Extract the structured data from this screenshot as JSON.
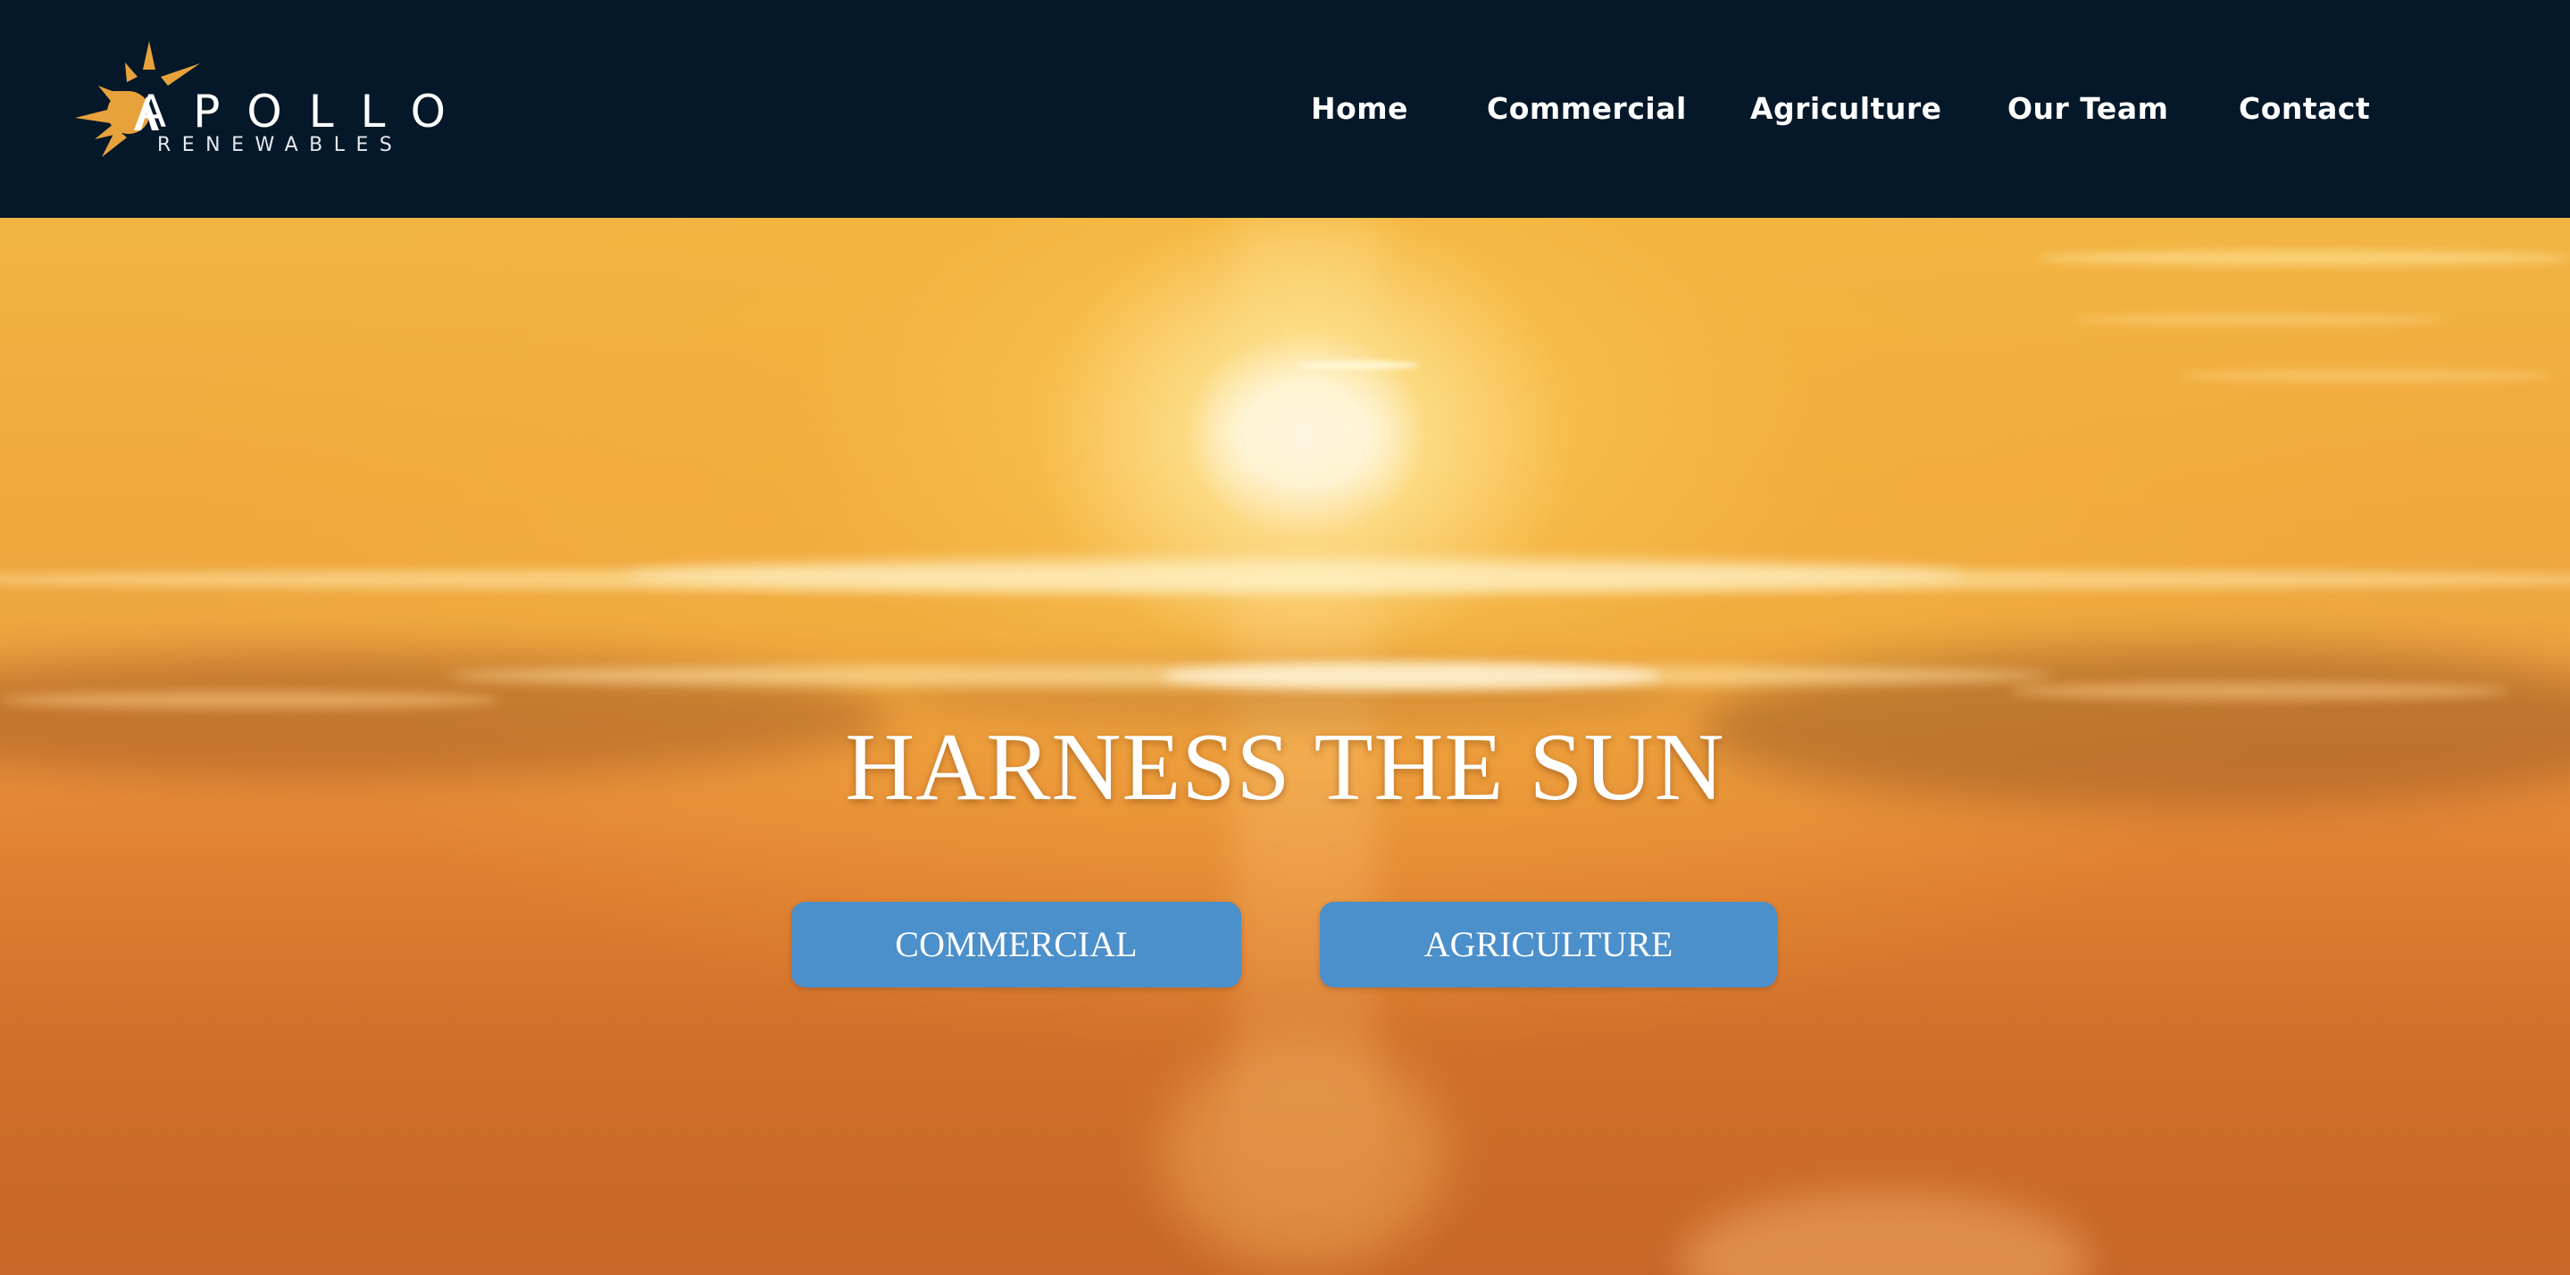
{
  "brand": {
    "logo_word": "APOLLO",
    "logo_sub": "RENEWABLES",
    "logo_icon": "sun-icon",
    "accent_color": "#e8a23c"
  },
  "nav": {
    "items": [
      {
        "label": "Home"
      },
      {
        "label": "Commercial"
      },
      {
        "label": "Agriculture"
      },
      {
        "label": "Our Team"
      },
      {
        "label": "Contact"
      }
    ],
    "background_color": "#041829"
  },
  "hero": {
    "title": "HARNESS THE SUN",
    "buttons": [
      {
        "label": "COMMERCIAL"
      },
      {
        "label": "AGRICULTURE"
      }
    ],
    "button_color": "#4b8fcb"
  }
}
